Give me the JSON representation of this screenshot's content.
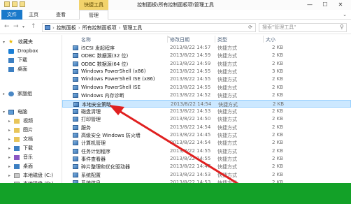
{
  "title": {
    "contextual_tab": "快捷工具",
    "window_title": "控制面板\\所有控制面板项\\管理工具",
    "minimize": "—",
    "maximize": "☐",
    "close": "✕"
  },
  "ribbon": {
    "tabs": [
      {
        "label": "文件"
      },
      {
        "label": "主页"
      },
      {
        "label": "查看"
      },
      {
        "label": "管理"
      }
    ]
  },
  "address": {
    "back": "←",
    "forward": "→",
    "up": "↑",
    "crumbs": [
      "控制面板",
      "所有控制面板项",
      "管理工具"
    ],
    "search_placeholder": "搜索\"管理工具\""
  },
  "nav": {
    "items": [
      {
        "label": "收藏夹"
      },
      {
        "label": "Dropbox"
      },
      {
        "label": "下载"
      },
      {
        "label": "桌面"
      },
      {
        "label": "家庭组"
      },
      {
        "label": "电脑"
      },
      {
        "label": "视频"
      },
      {
        "label": "图片"
      },
      {
        "label": "文档"
      },
      {
        "label": "下载"
      },
      {
        "label": "音乐"
      },
      {
        "label": "桌面"
      },
      {
        "label": "本地磁盘 (C:)"
      },
      {
        "label": "本地磁盘 (D:)"
      }
    ]
  },
  "columns": {
    "name": "名称",
    "date": "修改日期",
    "type": "类型",
    "size": "大小"
  },
  "files": [
    {
      "name": "iSCSI 发起程序",
      "date": "2013/8/22 14:57",
      "type": "快捷方式",
      "size": "2 KB"
    },
    {
      "name": "ODBC 数据源(32 位)",
      "date": "2013/8/22 14:59",
      "type": "快捷方式",
      "size": "2 KB"
    },
    {
      "name": "ODBC 数据源(64 位)",
      "date": "2013/8/22 14:59",
      "type": "快捷方式",
      "size": "2 KB"
    },
    {
      "name": "Windows PowerShell (x86)",
      "date": "2013/8/22 14:55",
      "type": "快捷方式",
      "size": "3 KB"
    },
    {
      "name": "Windows PowerShell ISE (x86)",
      "date": "2013/8/22 14:55",
      "type": "快捷方式",
      "size": "2 KB"
    },
    {
      "name": "Windows PowerShell ISE",
      "date": "2013/8/22 14:55",
      "type": "快捷方式",
      "size": "2 KB"
    },
    {
      "name": "Windows 内存诊断",
      "date": "2013/8/22 14:52",
      "type": "快捷方式",
      "size": "2 KB"
    },
    {
      "name": "本地安全策略",
      "date": "2013/8/22 14:54",
      "type": "快捷方式",
      "size": "2 KB"
    },
    {
      "name": "磁盘清理",
      "date": "2013/8/22 14:53",
      "type": "快捷方式",
      "size": "2 KB"
    },
    {
      "name": "打印管理",
      "date": "2013/8/22 14:50",
      "type": "快捷方式",
      "size": "2 KB"
    },
    {
      "name": "服务",
      "date": "2013/8/22 14:54",
      "type": "快捷方式",
      "size": "2 KB"
    },
    {
      "name": "高级安全 Windows 防火墙",
      "date": "2013/8/22 14:45",
      "type": "快捷方式",
      "size": "2 KB"
    },
    {
      "name": "计算机管理",
      "date": "2013/8/22 14:54",
      "type": "快捷方式",
      "size": "2 KB"
    },
    {
      "name": "任务计划程序",
      "date": "2013/8/22 14:55",
      "type": "快捷方式",
      "size": "2 KB"
    },
    {
      "name": "事件查看器",
      "date": "2013/8/22 14:55",
      "type": "快捷方式",
      "size": "2 KB"
    },
    {
      "name": "碎片整理和优化驱动器",
      "date": "2013/8/22 14:47",
      "type": "快捷方式",
      "size": "2 KB"
    },
    {
      "name": "系统配置",
      "date": "2013/8/22 14:53",
      "type": "快捷方式",
      "size": "2 KB"
    },
    {
      "name": "系统信息",
      "date": "2013/8/22 14:53",
      "type": "快捷方式",
      "size": "2 KB"
    }
  ],
  "selected_index": 7,
  "colors": {
    "accent": "#1979ca",
    "selection": "#cce8ff",
    "annotation_arrow": "#e02020",
    "footer_band": "#13a128"
  }
}
